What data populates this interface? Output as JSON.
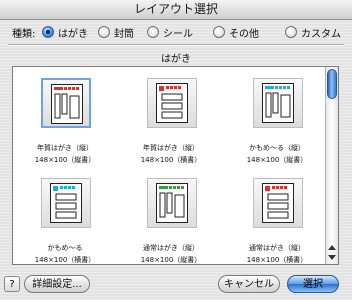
{
  "window": {
    "title": "レイアウト選択"
  },
  "type_selector": {
    "label": "種類:",
    "options": [
      {
        "label": "はがき",
        "selected": true
      },
      {
        "label": "封筒",
        "selected": false
      },
      {
        "label": "シール",
        "selected": false
      },
      {
        "label": "その他",
        "selected": false
      },
      {
        "label": "カスタム",
        "selected": false
      }
    ]
  },
  "section": {
    "title": "はがき"
  },
  "layouts": [
    {
      "name": "年賀はがき（縦）",
      "size": "148×100（縦書）",
      "selected": true,
      "accent": "#e0302a"
    },
    {
      "name": "年賀はがき（縦）",
      "size": "148×100（横書）",
      "selected": false,
      "accent": "#e0302a"
    },
    {
      "name": "かもめ～る（縦）",
      "size": "148×100（縦書）",
      "selected": false,
      "accent": "#24a7dc"
    },
    {
      "name": "かもめ～る",
      "size": "148×100（横書）",
      "selected": false,
      "accent": "#24a7dc"
    },
    {
      "name": "通常はがき（縦）",
      "size": "148×100（縦書）",
      "selected": false,
      "accent": "#2ea53a"
    },
    {
      "name": "通常はがき（縦）",
      "size": "148×100（横書）",
      "selected": false,
      "accent": "#e0302a"
    }
  ],
  "buttons": {
    "help": "?",
    "details": "詳細設定...",
    "cancel": "キャンセル",
    "select": "選択"
  }
}
